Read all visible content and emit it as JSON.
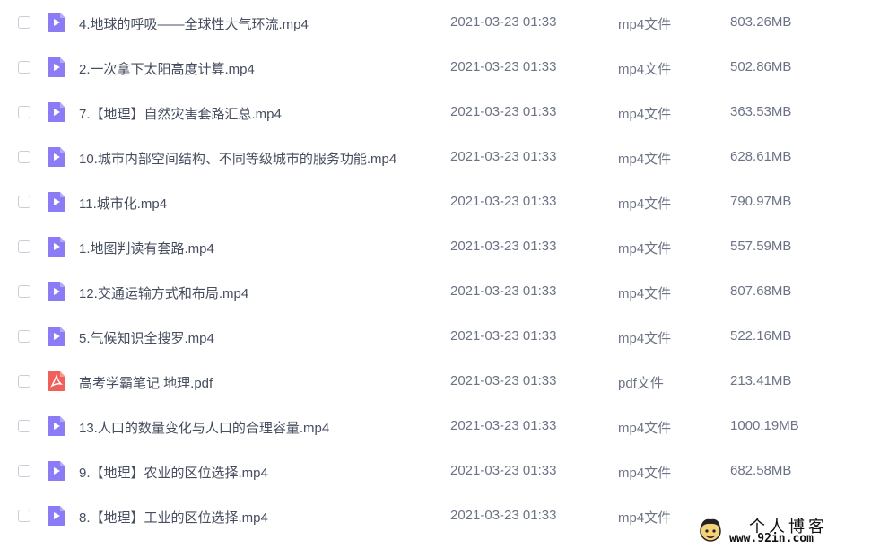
{
  "files": [
    {
      "name": "4.地球的呼吸——全球性大气环流.mp4",
      "date": "2021-03-23 01:33",
      "type": "mp4文件",
      "size": "803.26MB",
      "icon": "video-file-icon"
    },
    {
      "name": "2.一次拿下太阳高度计算.mp4",
      "date": "2021-03-23 01:33",
      "type": "mp4文件",
      "size": "502.86MB",
      "icon": "video-file-icon"
    },
    {
      "name": "7.【地理】自然灾害套路汇总.mp4",
      "date": "2021-03-23 01:33",
      "type": "mp4文件",
      "size": "363.53MB",
      "icon": "video-file-icon"
    },
    {
      "name": "10.城市内部空间结构、不同等级城市的服务功能.mp4",
      "date": "2021-03-23 01:33",
      "type": "mp4文件",
      "size": "628.61MB",
      "icon": "video-file-icon"
    },
    {
      "name": "11.城市化.mp4",
      "date": "2021-03-23 01:33",
      "type": "mp4文件",
      "size": "790.97MB",
      "icon": "video-file-icon"
    },
    {
      "name": "1.地图判读有套路.mp4",
      "date": "2021-03-23 01:33",
      "type": "mp4文件",
      "size": "557.59MB",
      "icon": "video-file-icon"
    },
    {
      "name": "12.交通运输方式和布局.mp4",
      "date": "2021-03-23 01:33",
      "type": "mp4文件",
      "size": "807.68MB",
      "icon": "video-file-icon"
    },
    {
      "name": "5.气候知识全搜罗.mp4",
      "date": "2021-03-23 01:33",
      "type": "mp4文件",
      "size": "522.16MB",
      "icon": "video-file-icon"
    },
    {
      "name": "高考学霸笔记 地理.pdf",
      "date": "2021-03-23 01:33",
      "type": "pdf文件",
      "size": "213.41MB",
      "icon": "pdf-file-icon"
    },
    {
      "name": "13.人口的数量变化与人口的合理容量.mp4",
      "date": "2021-03-23 01:33",
      "type": "mp4文件",
      "size": "1000.19MB",
      "icon": "video-file-icon"
    },
    {
      "name": "9.【地理】农业的区位选择.mp4",
      "date": "2021-03-23 01:33",
      "type": "mp4文件",
      "size": "682.58MB",
      "icon": "video-file-icon"
    },
    {
      "name": "8.【地理】工业的区位选择.mp4",
      "date": "2021-03-23 01:33",
      "type": "mp4文件",
      "size": "",
      "icon": "video-file-icon"
    }
  ],
  "colors": {
    "video_icon": "#8b7cf6",
    "pdf_icon": "#f0605a"
  },
  "watermark": {
    "title": "个人博客",
    "url": "www.92in.com"
  }
}
